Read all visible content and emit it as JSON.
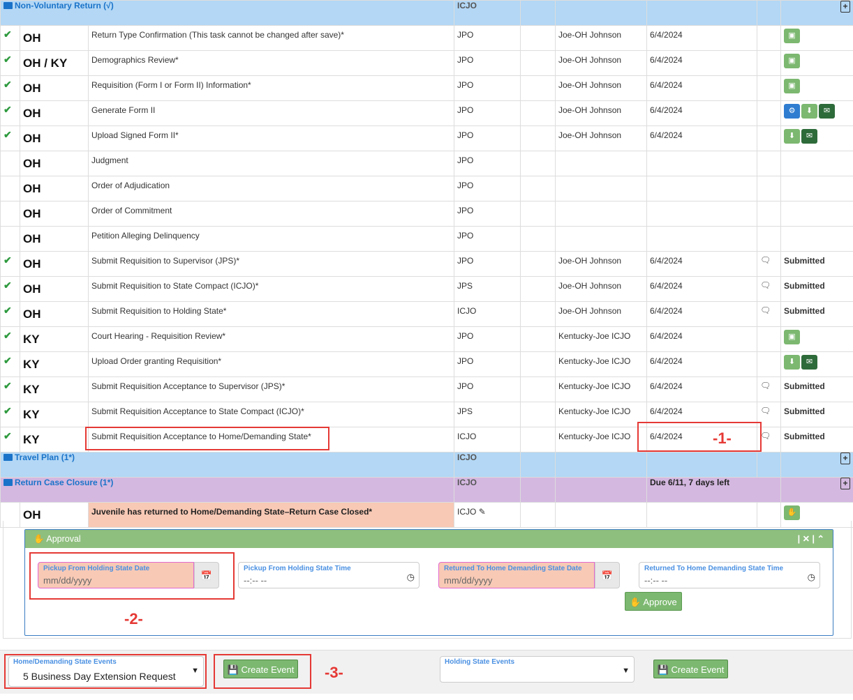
{
  "sections": {
    "nvr": {
      "title": "Non-Voluntary Return (√)",
      "owner": "ICJO"
    },
    "travel": {
      "title": "Travel Plan (1*)",
      "owner": "ICJO"
    },
    "closure": {
      "title": "Return Case Closure (1*)",
      "owner": "ICJO",
      "due": "Due 6/11, 7 days left"
    }
  },
  "rows": [
    {
      "check": "✔",
      "state": "OH",
      "task": "Return Type Confirmation (This task cannot be changed after save)*",
      "role": "JPO",
      "user": "Joe-OH Johnson",
      "date": "6/4/2024"
    },
    {
      "check": "✔",
      "state": "OH / KY",
      "task": "Demographics Review*",
      "role": "JPO",
      "user": "Joe-OH Johnson",
      "date": "6/4/2024"
    },
    {
      "check": "✔",
      "state": "OH",
      "task": "Requisition (Form I or Form II) Information*",
      "role": "JPO",
      "user": "Joe-OH Johnson",
      "date": "6/4/2024"
    },
    {
      "check": "✔",
      "state": "OH",
      "task": "Generate Form II",
      "role": "JPO",
      "user": "Joe-OH Johnson",
      "date": "6/4/2024"
    },
    {
      "check": "✔",
      "state": "OH",
      "task": "Upload Signed Form II*",
      "role": "JPO",
      "user": "Joe-OH Johnson",
      "date": "6/4/2024"
    },
    {
      "check": "",
      "state": "OH",
      "task": "Judgment",
      "role": "JPO",
      "user": "",
      "date": ""
    },
    {
      "check": "",
      "state": "OH",
      "task": "Order of Adjudication",
      "role": "JPO",
      "user": "",
      "date": ""
    },
    {
      "check": "",
      "state": "OH",
      "task": "Order of Commitment",
      "role": "JPO",
      "user": "",
      "date": ""
    },
    {
      "check": "",
      "state": "OH",
      "task": "Petition Alleging Delinquency",
      "role": "JPO",
      "user": "",
      "date": ""
    },
    {
      "check": "✔",
      "state": "OH",
      "task": "Submit Requisition to Supervisor (JPS)*",
      "role": "JPO",
      "user": "Joe-OH Johnson",
      "date": "6/4/2024",
      "status": "Submitted"
    },
    {
      "check": "✔",
      "state": "OH",
      "task": "Submit Requisition to State Compact (ICJO)*",
      "role": "JPS",
      "user": "Joe-OH Johnson",
      "date": "6/4/2024",
      "status": "Submitted"
    },
    {
      "check": "✔",
      "state": "OH",
      "task": "Submit Requisition to Holding State*",
      "role": "ICJO",
      "user": "Joe-OH Johnson",
      "date": "6/4/2024",
      "status": "Submitted"
    },
    {
      "check": "✔",
      "state": "KY",
      "task": "Court Hearing - Requisition Review*",
      "role": "JPO",
      "user": "Kentucky-Joe ICJO",
      "date": "6/4/2024"
    },
    {
      "check": "✔",
      "state": "KY",
      "task": "Upload Order granting Requisition*",
      "role": "JPO",
      "user": "Kentucky-Joe ICJO",
      "date": "6/4/2024"
    },
    {
      "check": "✔",
      "state": "KY",
      "task": "Submit Requisition Acceptance to Supervisor (JPS)*",
      "role": "JPO",
      "user": "Kentucky-Joe ICJO",
      "date": "6/4/2024",
      "status": "Submitted"
    },
    {
      "check": "✔",
      "state": "KY",
      "task": "Submit Requisition Acceptance to State Compact (ICJO)*",
      "role": "JPS",
      "user": "Kentucky-Joe ICJO",
      "date": "6/4/2024",
      "status": "Submitted"
    },
    {
      "check": "✔",
      "state": "KY",
      "task": "Submit Requisition Acceptance to Home/Demanding State*",
      "role": "ICJO",
      "user": "Kentucky-Joe ICJO",
      "date": "6/4/2024",
      "status": "Submitted"
    }
  ],
  "closure_row": {
    "state": "OH",
    "task": "Juvenile has returned to Home/Demanding State–Return Case Closed*",
    "role": "ICJO"
  },
  "approval": {
    "title": "Approval",
    "controls": "| ✕ | ⌃",
    "pickup_date_label": "Pickup From Holding State Date",
    "pickup_date_placeholder": "mm/dd/yyyy",
    "pickup_time_label": "Pickup From Holding State Time",
    "pickup_time_placeholder": "--:-- --",
    "return_date_label": "Returned To Home Demanding State Date",
    "return_date_placeholder": "mm/dd/yyyy",
    "return_time_label": "Returned To Home Demanding State Time",
    "return_time_placeholder": "--:-- --",
    "approve_label": "Approve"
  },
  "footer": {
    "home_events_label": "Home/Demanding State Events",
    "home_events_value": "5 Business Day Extension Request",
    "create_event_label": "Create Event",
    "holding_events_label": "Holding State Events",
    "holding_events_value": "",
    "create_event_label_2": "Create Event"
  },
  "annotations": {
    "one": "-1-",
    "two": "-2-",
    "three": "-3-"
  },
  "colors": {
    "accent_blue": "#1a73c9",
    "green_button": "#7cb870",
    "dark_green": "#2e6b3a",
    "header_blue": "#b3d7f5",
    "header_purple": "#d4b8e0",
    "annotation_red": "#e53935"
  }
}
